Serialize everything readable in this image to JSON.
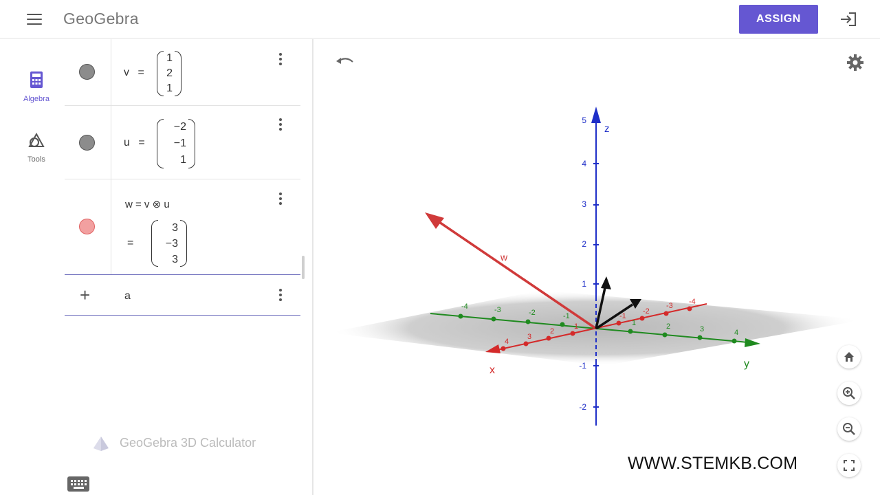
{
  "app": {
    "logo_text": "GeoGebra",
    "assign_label": "ASSIGN",
    "brand_color": "#6557d2"
  },
  "rail": {
    "items": [
      {
        "label": "Algebra",
        "icon": "calculator-icon",
        "active": true
      },
      {
        "label": "Tools",
        "icon": "tools-icon",
        "active": false
      }
    ]
  },
  "algebra": {
    "rows": [
      {
        "name": "v",
        "op": "=",
        "vector": [
          "1",
          "2",
          "1"
        ],
        "marble": "gray"
      },
      {
        "name": "u",
        "op": "=",
        "vector": [
          "−2",
          "−1",
          "1"
        ],
        "marble": "gray"
      },
      {
        "definition": "w = v ⊗ u",
        "op": "=",
        "vector": [
          "3",
          "−3",
          "3"
        ],
        "marble": "red"
      }
    ],
    "input_value": "a",
    "watermark": "GeoGebra 3D Calculator"
  },
  "graphics": {
    "axis_labels": {
      "x": "x",
      "y": "y",
      "z": "z"
    },
    "z_ticks": [
      "5",
      "4",
      "3",
      "2",
      "1",
      "-1",
      "-2"
    ],
    "x_ticks": [
      "4",
      "3",
      "2",
      "1",
      "-1",
      "-2",
      "-3",
      "-4"
    ],
    "y_ticks": [
      "-4",
      "-3",
      "-2",
      "-1",
      "1",
      "2",
      "3",
      "4"
    ],
    "vector_label_w": "w",
    "website": "WWW.STEMKB.COM",
    "colors": {
      "x_axis": "#d42a2a",
      "y_axis": "#1f8a1f",
      "z_axis": "#1f2fc8",
      "vector_w": "#d03a3a",
      "vectors_uv": "#111111",
      "plane": "#bdbdbd"
    }
  }
}
